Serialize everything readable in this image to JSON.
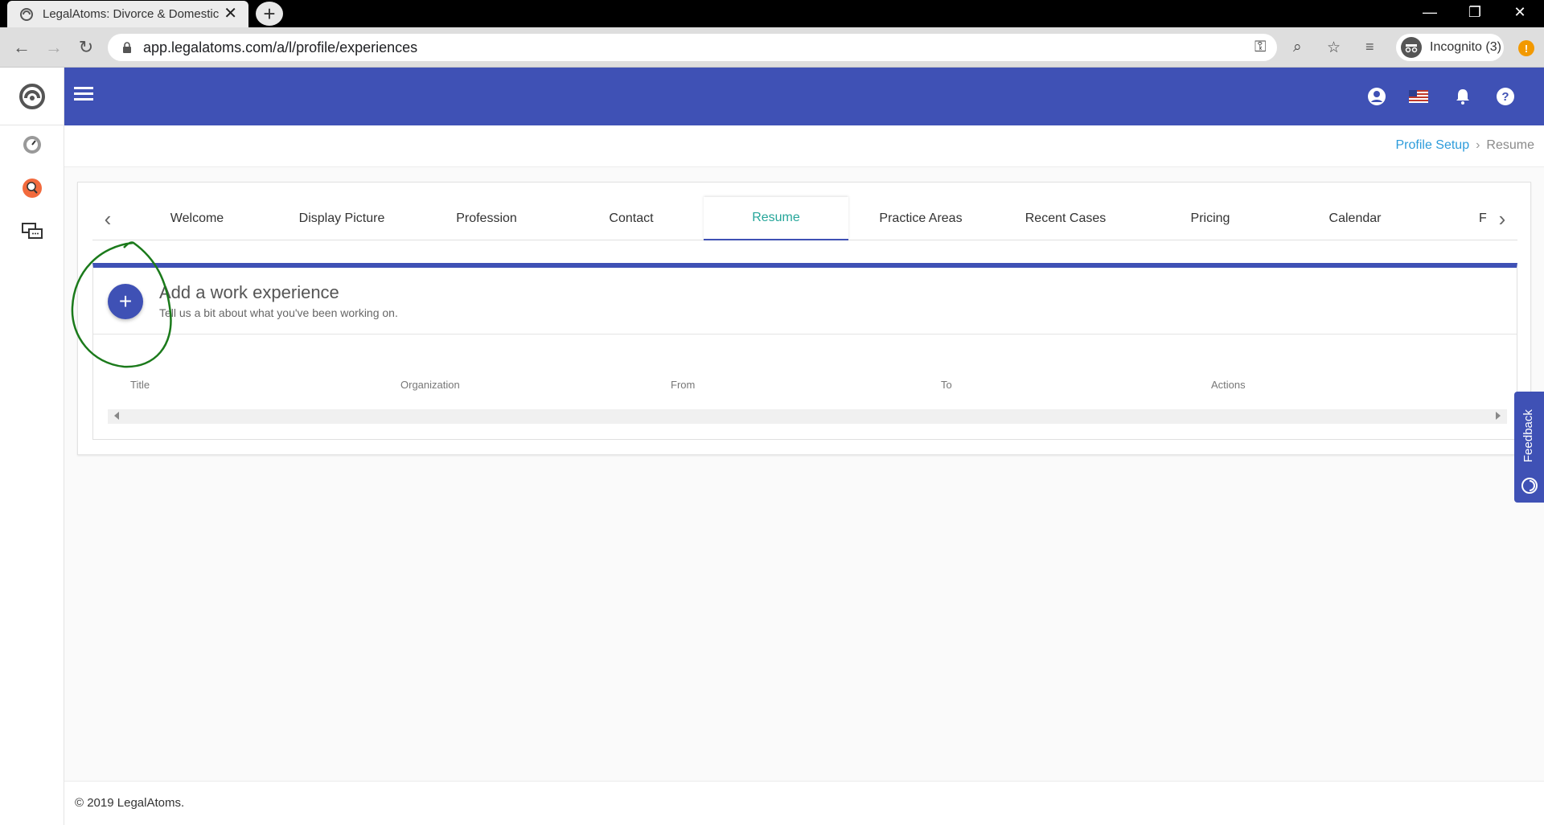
{
  "browser": {
    "tab_title": "LegalAtoms: Divorce & Domestic",
    "url": "app.legalatoms.com/a/l/profile/experiences",
    "incognito_label": "Incognito (3)",
    "alert_badge": "!"
  },
  "breadcrumb": {
    "parent": "Profile Setup",
    "separator": "›",
    "current": "Resume"
  },
  "steps": {
    "items": [
      "Welcome",
      "Display Picture",
      "Profession",
      "Contact",
      "Resume",
      "Practice Areas",
      "Recent Cases",
      "Pricing",
      "Calendar"
    ],
    "truncated_next": "F",
    "active": "Resume"
  },
  "experience": {
    "add_title": "Add a work experience",
    "add_subtitle": "Tell us a bit about what you've been working on.",
    "columns": [
      "Title",
      "Organization",
      "From",
      "To",
      "Actions"
    ]
  },
  "feedback": {
    "label": "Feedback"
  },
  "footer": {
    "copyright": "© 2019 LegalAtoms."
  },
  "colors": {
    "brand": "#3f51b5",
    "active_tab_text": "#26a69a",
    "breadcrumb_link": "#2d9cdb",
    "annotation": "#1b7a1b"
  }
}
